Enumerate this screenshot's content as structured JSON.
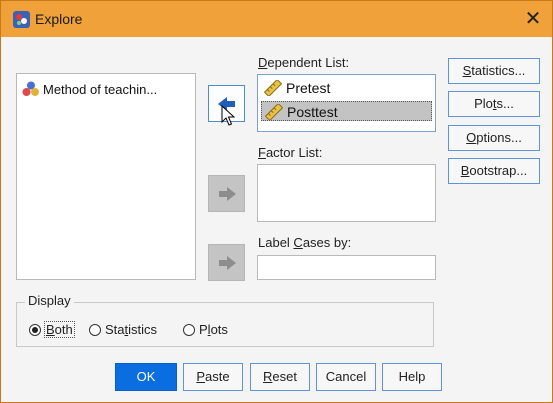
{
  "window": {
    "title": "Explore",
    "close_glyph": "✕"
  },
  "source_list": {
    "items": [
      {
        "label": "Method of teachin...",
        "icon": "nominal-variable-icon"
      }
    ]
  },
  "dependent_list": {
    "label_pre": "",
    "label_key": "D",
    "label_post": "ependent List:",
    "items": [
      {
        "label": "Pretest",
        "icon": "ruler-scale-icon",
        "selected": false
      },
      {
        "label": "Posttest",
        "icon": "ruler-scale-icon",
        "selected": true
      }
    ]
  },
  "factor_list": {
    "label_key": "F",
    "label_post": "actor List:"
  },
  "label_cases": {
    "label_pre": "Label ",
    "label_key": "C",
    "label_post": "ases by:"
  },
  "side_buttons": [
    {
      "pre": "",
      "key": "S",
      "post": "tatistics..."
    },
    {
      "pre": "Plo",
      "key": "t",
      "post": "s..."
    },
    {
      "pre": "",
      "key": "O",
      "post": "ptions..."
    },
    {
      "pre": "",
      "key": "B",
      "post": "ootstrap..."
    }
  ],
  "display": {
    "legend": "Display",
    "options": [
      {
        "pre": "",
        "key": "B",
        "post": "oth",
        "checked": true
      },
      {
        "pre": "Sta",
        "key": "t",
        "post": "istics",
        "checked": false
      },
      {
        "pre": "P",
        "key": "l",
        "post": "ots",
        "checked": false
      }
    ]
  },
  "bottom_buttons": [
    {
      "pre": "OK",
      "key": "",
      "post": ""
    },
    {
      "pre": "",
      "key": "P",
      "post": "aste"
    },
    {
      "pre": "",
      "key": "R",
      "post": "eset"
    },
    {
      "pre": "Cancel",
      "key": "",
      "post": ""
    },
    {
      "pre": "Help",
      "key": "",
      "post": ""
    }
  ],
  "colors": {
    "title_bar": "#f0a139",
    "ok_button": "#0a6ee0",
    "button_border": "#5d95d6"
  }
}
